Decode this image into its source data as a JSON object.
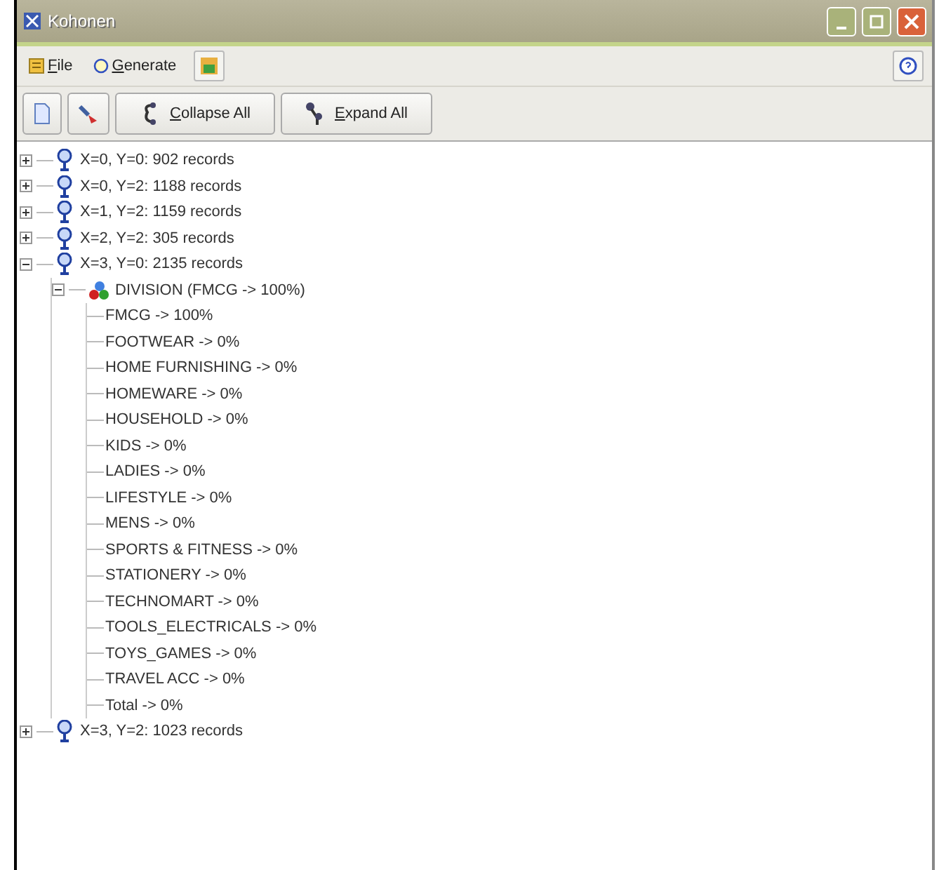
{
  "window": {
    "title": "Kohonen"
  },
  "menu": [
    {
      "label": "File",
      "kind": "file"
    },
    {
      "label": "Generate",
      "kind": "generate"
    },
    {
      "kind": "image-button"
    }
  ],
  "toolbar": [
    {
      "kind": "copy"
    },
    {
      "kind": "tool"
    },
    {
      "kind": "collapse",
      "label": "Collapse All"
    },
    {
      "kind": "expand",
      "label": "Expand All"
    }
  ],
  "tree": [
    {
      "label": "X=0, Y=0: 902 records",
      "kind": "cluster",
      "expanded": false
    },
    {
      "label": "X=0, Y=2: 1188 records",
      "kind": "cluster",
      "expanded": false
    },
    {
      "label": "X=1, Y=2: 1159 records",
      "kind": "cluster",
      "expanded": false
    },
    {
      "label": "X=2, Y=2: 305 records",
      "kind": "cluster",
      "expanded": false
    },
    {
      "label": "X=3, Y=0: 2135 records",
      "kind": "cluster",
      "expanded": true,
      "children": [
        {
          "label": "DIVISION (FMCG -> 100%)",
          "kind": "field",
          "expanded": true,
          "children": [
            {
              "label": "FMCG -> 100%"
            },
            {
              "label": "FOOTWEAR -> 0%"
            },
            {
              "label": "HOME FURNISHING -> 0%"
            },
            {
              "label": "HOMEWARE -> 0%"
            },
            {
              "label": "HOUSEHOLD -> 0%"
            },
            {
              "label": "KIDS -> 0%"
            },
            {
              "label": "LADIES -> 0%"
            },
            {
              "label": "LIFESTYLE -> 0%"
            },
            {
              "label": "MENS -> 0%"
            },
            {
              "label": "SPORTS & FITNESS -> 0%"
            },
            {
              "label": "STATIONERY -> 0%"
            },
            {
              "label": "TECHNOMART -> 0%"
            },
            {
              "label": "TOOLS_ELECTRICALS -> 0%"
            },
            {
              "label": "TOYS_GAMES -> 0%"
            },
            {
              "label": "TRAVEL ACC -> 0%"
            },
            {
              "label": "Total -> 0%"
            }
          ]
        }
      ]
    },
    {
      "label": "X=3, Y=2: 1023 records",
      "kind": "cluster",
      "expanded": false
    }
  ]
}
